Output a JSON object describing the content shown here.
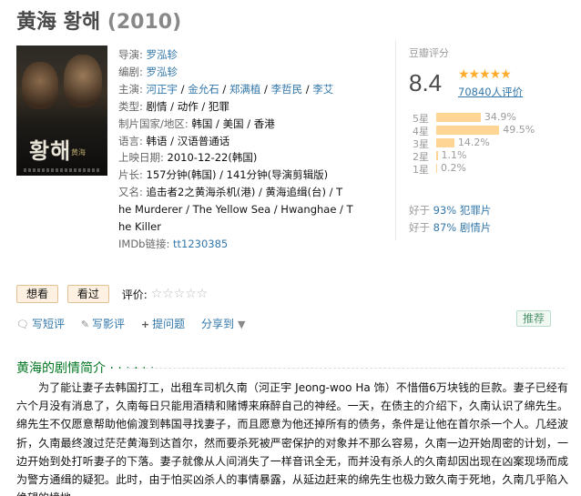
{
  "header": {
    "title": "黄海 황해",
    "year": "(2010)"
  },
  "info": {
    "director_label": "导演",
    "director": "罗泓轸",
    "writer_label": "编剧",
    "writer": "罗泓轸",
    "cast_label": "主演",
    "cast": [
      "河正宇",
      "金允石",
      "郑满植",
      "李哲民",
      "李艾"
    ],
    "genre_label": "类型",
    "genres": [
      "剧情",
      "动作",
      "犯罪"
    ],
    "country_label": "制片国家/地区",
    "countries": [
      "韩国",
      "美国",
      "香港"
    ],
    "language_label": "语言",
    "languages": "韩语 / 汉语普通话",
    "release_label": "上映日期",
    "release": "2010-12-22(韩国)",
    "runtime_label": "片长",
    "runtime": "157分钟(韩国) / 141分钟(导演剪辑版)",
    "aka_label": "又名",
    "aka_line1": "追击者2之黄海杀机(港) / 黄海追缉(台) / T",
    "aka_line2": "he Murderer / The Yellow Sea / Hwanghae / T",
    "aka_line3": "he Killer",
    "imdb_label": "IMDb链接",
    "imdb": "tt1230385"
  },
  "rating": {
    "title": "豆瓣评分",
    "score": "8.4",
    "stars": "★★★★★",
    "count": "70840人评价",
    "distribution": [
      {
        "label": "5星",
        "pct": "34.9%",
        "value": 34.9
      },
      {
        "label": "4星",
        "pct": "49.5%",
        "value": 49.5
      },
      {
        "label": "3星",
        "pct": "14.2%",
        "value": 14.2
      },
      {
        "label": "2星",
        "pct": "1.1%",
        "value": 1.1
      },
      {
        "label": "1星",
        "pct": "0.2%",
        "value": 0.2
      }
    ],
    "better1_prefix": "好于",
    "better1_value": "93% 犯罪片",
    "better2_prefix": "好于",
    "better2_value": "87% 剧情片"
  },
  "actions": {
    "want": "想看",
    "seen": "看过",
    "rate_label": "评价:",
    "empty_stars": "☆☆☆☆☆"
  },
  "ops": {
    "short_review": "写短评",
    "review": "写影评",
    "question": "提问题",
    "share": "分享到",
    "recommend": "推荐"
  },
  "intro": {
    "title": "黄海的剧情简介 · · · · · ·",
    "text": "为了能让妻子去韩国打工，出租车司机久南（河正宇 Jeong-woo Ha 饰）不惜借6万块钱的巨款。妻子已经有六个月没有消息了，久南每日只能用酒精和赌博来麻醉自己的神经。一天，在债主的介绍下，久南认识了绵先生。绵先生不仅愿意帮助他偷渡到韩国寻找妻子，而且愿意为他还掉所有的债务，条件是让他在首尔杀一个人。几经波折，久南最终渡过茫茫黄海到达首尔，然而要杀死被严密保护的对象并不那么容易，久南一边开始周密的计划，一边开始到处打听妻子的下落。妻子就像从人间消失了一样音讯全无，而并没有杀人的久南却因出现在凶案现场而成为警方通缉的疑犯。此时，由于怕买凶杀人的事情暴露，从延边赶来的绵先生也极力致久南于死地，久南几乎陷入绝望的境地……"
  }
}
